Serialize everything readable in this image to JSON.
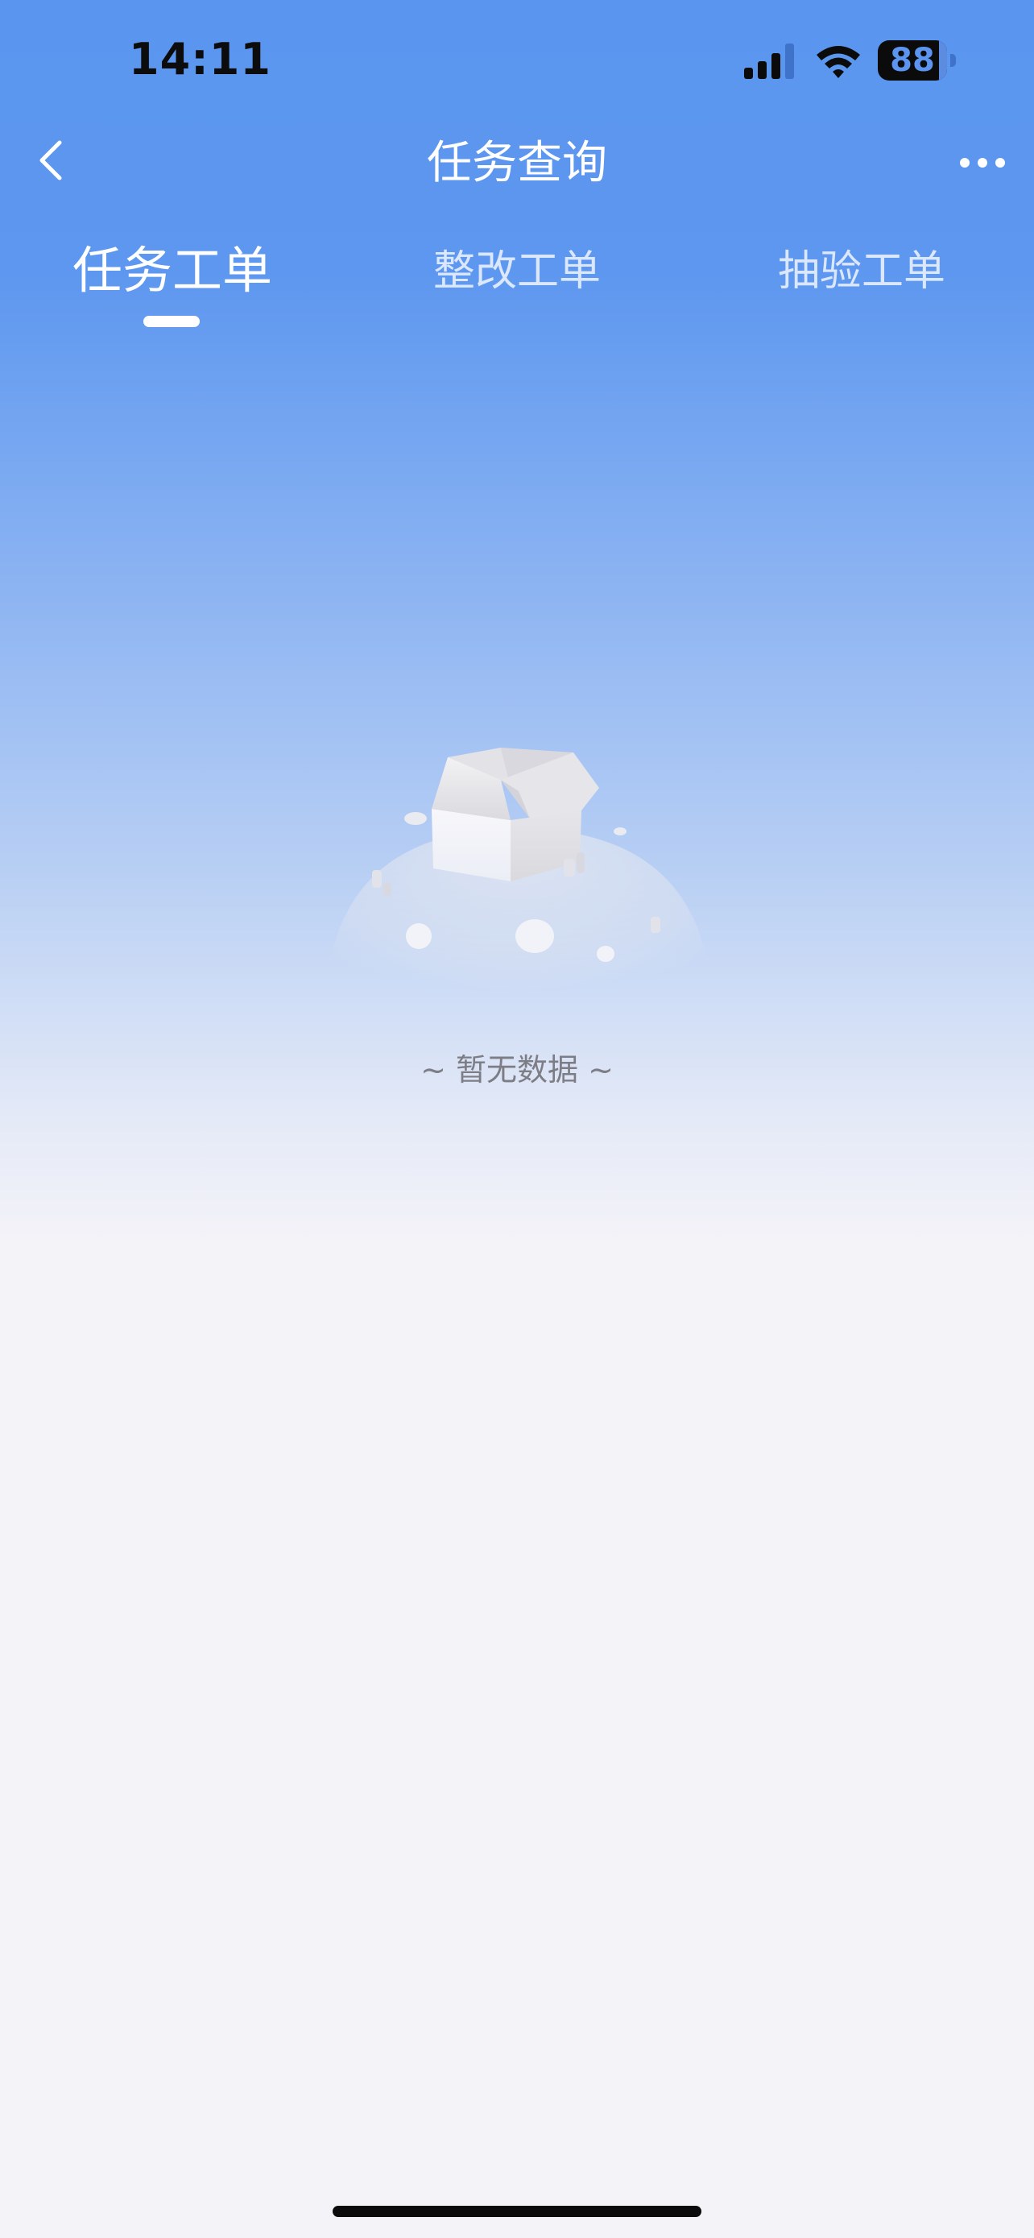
{
  "status_bar": {
    "time": "14:11",
    "battery_percent": "88",
    "battery_level": 0.88
  },
  "nav": {
    "title": "任务查询",
    "back_icon": "chevron-left-icon",
    "more_icon": "ellipsis-icon"
  },
  "tabs": [
    {
      "label": "任务工单",
      "active": true
    },
    {
      "label": "整改工单",
      "active": false
    },
    {
      "label": "抽验工单",
      "active": false
    }
  ],
  "empty_state": {
    "message": "~ 暂无数据 ~",
    "icon": "open-box-icon"
  },
  "colors": {
    "header_blue": "#5a95ef",
    "page_background": "#f4f3f8",
    "empty_text": "#7d7d85"
  }
}
